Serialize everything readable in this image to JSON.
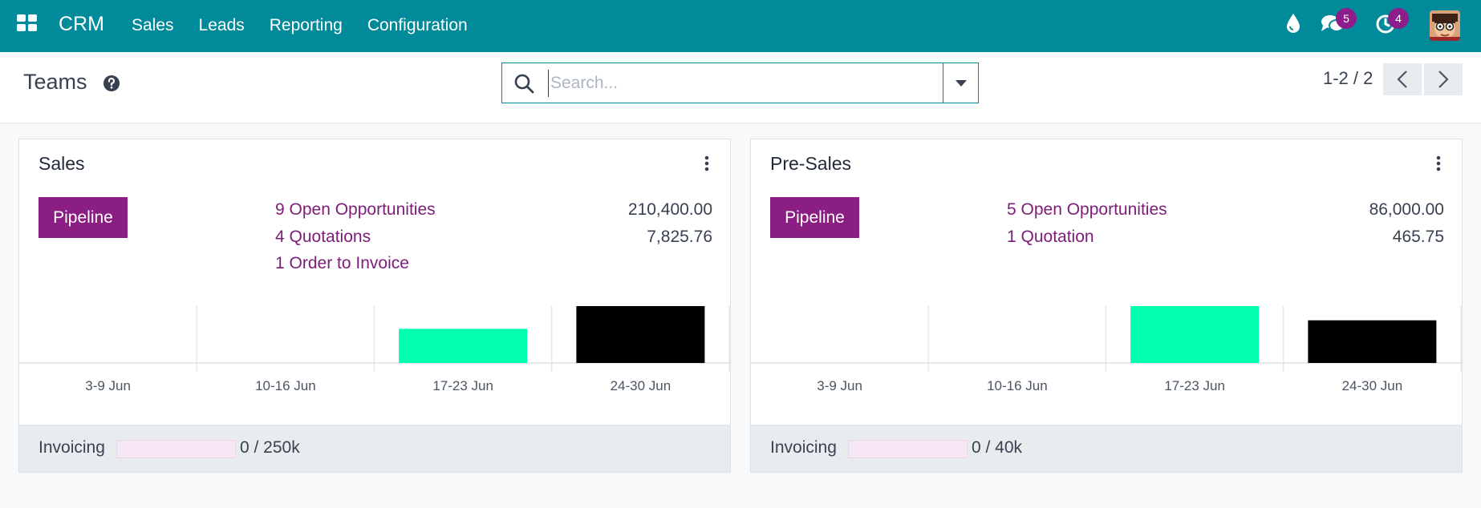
{
  "navbar": {
    "brand": "CRM",
    "menu": [
      "Sales",
      "Leads",
      "Reporting",
      "Configuration"
    ],
    "messages_badge": "5",
    "activities_badge": "4",
    "bg_color": "#018a9a"
  },
  "control_panel": {
    "title": "Teams",
    "search_placeholder": "Search...",
    "pager": "1-2 / 2"
  },
  "teams": [
    {
      "name": "Sales",
      "pipeline_label": "Pipeline",
      "stats": [
        {
          "label": "9 Open Opportunities",
          "value": "210,400.00"
        },
        {
          "label": "4 Quotations",
          "value": "7,825.76"
        },
        {
          "label": "1 Order to Invoice",
          "value": ""
        }
      ],
      "chart_data": {
        "type": "bar",
        "categories": [
          "3-9 Jun",
          "10-16 Jun",
          "17-23 Jun",
          "24-30 Jun"
        ],
        "values": [
          0,
          0,
          30,
          50
        ],
        "colors": [
          "#000000",
          "#000000",
          "#00ffae",
          "#000000"
        ]
      },
      "invoicing_label": "Invoicing",
      "invoicing_progress": 0,
      "invoicing_text": "0 /  250k"
    },
    {
      "name": "Pre-Sales",
      "pipeline_label": "Pipeline",
      "stats": [
        {
          "label": "5 Open Opportunities",
          "value": "86,000.00"
        },
        {
          "label": "1 Quotation",
          "value": "465.75"
        }
      ],
      "chart_data": {
        "type": "bar",
        "categories": [
          "3-9 Jun",
          "10-16 Jun",
          "17-23 Jun",
          "24-30 Jun"
        ],
        "values": [
          0,
          0,
          60,
          45
        ],
        "colors": [
          "#000000",
          "#000000",
          "#00ffae",
          "#000000"
        ]
      },
      "invoicing_label": "Invoicing",
      "invoicing_progress": 0,
      "invoicing_text": "0 /  40k"
    }
  ]
}
